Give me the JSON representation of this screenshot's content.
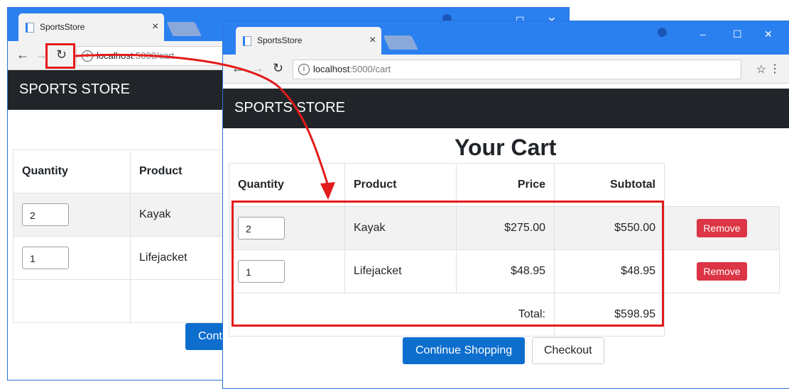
{
  "browser": {
    "tab_title": "SportsStore",
    "tab_close": "×",
    "url_host": "localhost",
    "url_path": ":5000/cart",
    "controls": {
      "minimize": "–",
      "maximize": "☐",
      "close": "✕"
    }
  },
  "app": {
    "brand": "SPORTS STORE"
  },
  "cart": {
    "title": "Your Cart",
    "headers": {
      "quantity": "Quantity",
      "product": "Product",
      "price": "Price",
      "subtotal": "Subtotal"
    },
    "rows": [
      {
        "quantity": "2",
        "product": "Kayak",
        "price": "$275.00",
        "subtotal": "$550.00",
        "remove_label": "Remove"
      },
      {
        "quantity": "1",
        "product": "Lifejacket",
        "price": "$48.95",
        "subtotal": "$48.95",
        "remove_label": "Remove"
      }
    ],
    "total_label": "Total:",
    "total_value": "$598.95"
  },
  "actions": {
    "continue_label": "Continue Shopping",
    "continue_cut": "Cont",
    "checkout_label": "Checkout"
  },
  "annotation_color": "#e31b1b",
  "accent_color": "#0d6ecd"
}
